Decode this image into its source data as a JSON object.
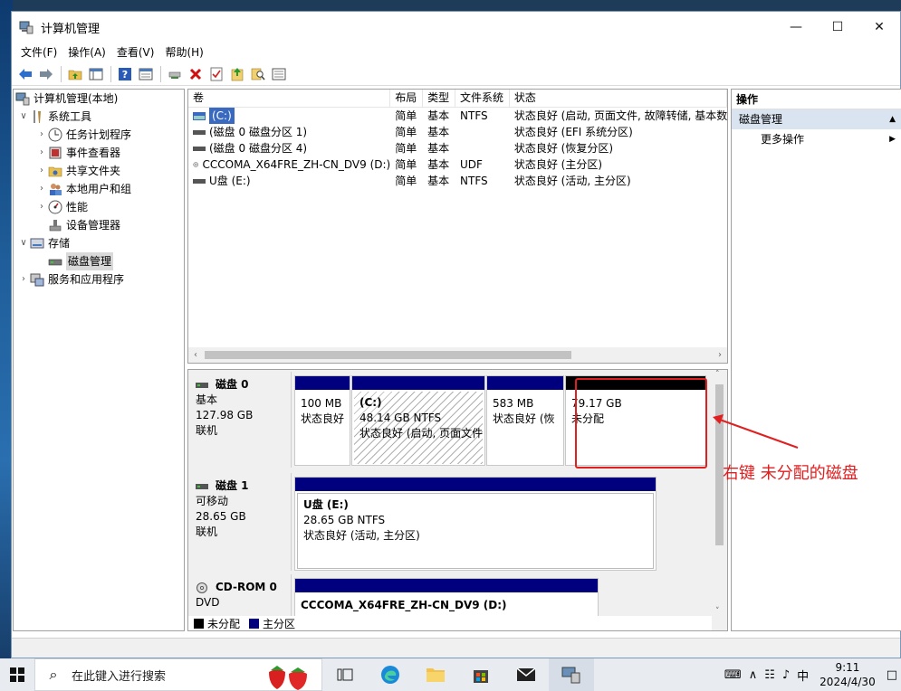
{
  "window": {
    "title": "计算机管理",
    "minimize": "—",
    "maximize": "☐",
    "close": "✕"
  },
  "menu": [
    "文件(F)",
    "操作(A)",
    "查看(V)",
    "帮助(H)"
  ],
  "tree": {
    "root": "计算机管理(本地)",
    "system_tools": "系统工具",
    "task_scheduler": "任务计划程序",
    "event_viewer": "事件查看器",
    "shared_folders": "共享文件夹",
    "local_users": "本地用户和组",
    "performance": "性能",
    "device_manager": "设备管理器",
    "storage": "存储",
    "disk_management": "磁盘管理",
    "services": "服务和应用程序"
  },
  "volume_list": {
    "headers": [
      "卷",
      "布局",
      "类型",
      "文件系统",
      "状态"
    ],
    "rows": [
      {
        "name": "(C:)",
        "layout": "简单",
        "type": "基本",
        "fs": "NTFS",
        "status": "状态良好 (启动, 页面文件, 故障转储, 基本数"
      },
      {
        "name": "(磁盘 0 磁盘分区 1)",
        "layout": "简单",
        "type": "基本",
        "fs": "",
        "status": "状态良好 (EFI 系统分区)"
      },
      {
        "name": "(磁盘 0 磁盘分区 4)",
        "layout": "简单",
        "type": "基本",
        "fs": "",
        "status": "状态良好 (恢复分区)"
      },
      {
        "name": "CCCOMA_X64FRE_ZH-CN_DV9 (D:)",
        "layout": "简单",
        "type": "基本",
        "fs": "UDF",
        "status": "状态良好 (主分区)"
      },
      {
        "name": "U盘 (E:)",
        "layout": "简单",
        "type": "基本",
        "fs": "NTFS",
        "status": "状态良好 (活动, 主分区)"
      }
    ]
  },
  "disks": {
    "disk0": {
      "name": "磁盘 0",
      "kind": "基本",
      "size": "127.98 GB",
      "state": "联机",
      "p1": {
        "size": "100 MB",
        "status": "状态良好"
      },
      "p2": {
        "label": "(C:)",
        "size": "48.14 GB NTFS",
        "status": "状态良好 (启动, 页面文件"
      },
      "p3": {
        "size": "583 MB",
        "status": "状态良好 (恢"
      },
      "p4": {
        "size": "79.17 GB",
        "status": "未分配"
      }
    },
    "disk1": {
      "name": "磁盘 1",
      "kind": "可移动",
      "size": "28.65 GB",
      "state": "联机",
      "p1": {
        "label": "U盘  (E:)",
        "size": "28.65 GB NTFS",
        "status": "状态良好 (活动, 主分区)"
      }
    },
    "cdrom0": {
      "name": "CD-ROM 0",
      "kind": "DVD",
      "p1": {
        "label": "CCCOMA_X64FRE_ZH-CN_DV9  (D:)"
      }
    }
  },
  "legend": {
    "unallocated": "未分配",
    "primary": "主分区"
  },
  "actions": {
    "header": "操作",
    "section": "磁盘管理",
    "more": "更多操作"
  },
  "annotation": {
    "text": "右键 未分配的磁盘"
  },
  "taskbar": {
    "search_placeholder": "在此键入进行搜索",
    "ime": "中",
    "time": "9:11",
    "date": "2024/4/30"
  },
  "colors": {
    "primary_partition": "#00007f",
    "unallocated": "#000000",
    "annotation": "#e02020"
  }
}
